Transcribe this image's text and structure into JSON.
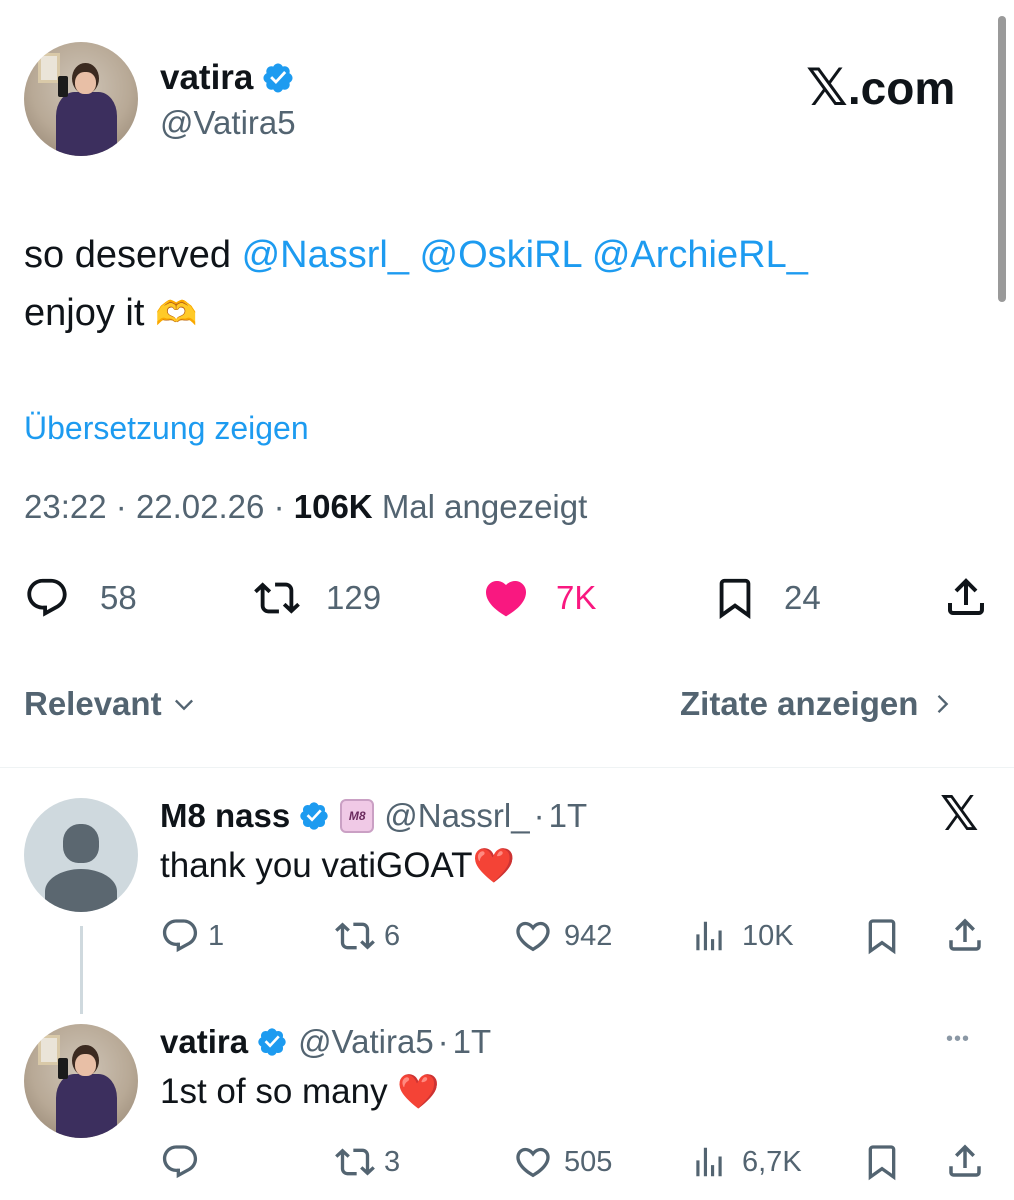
{
  "brand": {
    "logo_glyph": "𝕏",
    "logo_text": ".com"
  },
  "post": {
    "author_name": "vatira",
    "author_handle": "@Vatira5",
    "text_plain_1": "so deserved ",
    "mention_1": "@Nassrl_",
    "mention_2": "@OskiRL",
    "mention_3": "@ArchieRL_",
    "text_plain_2": "enjoy it ",
    "emoji": "🫶",
    "translate_label": "Übersetzung zeigen",
    "time": "23:22",
    "separator": "·",
    "date": "22.02.26",
    "views_count": "106K",
    "views_label": "Mal angezeigt",
    "actions": {
      "replies": "58",
      "reposts": "129",
      "likes": "7K",
      "bookmarks": "24"
    }
  },
  "sort": {
    "label": "Relevant",
    "quotes_label": "Zitate anzeigen"
  },
  "replies": [
    {
      "author_name": "M8 nass",
      "affiliate_badge": "M8",
      "author_handle": "@Nassrl_",
      "separator": "·",
      "time": "1T",
      "text": "thank you vatiGOAT",
      "emoji": "❤️",
      "corner_glyph": "𝕏",
      "actions": {
        "replies": "1",
        "reposts": "6",
        "likes": "942",
        "views": "10K"
      }
    },
    {
      "author_name": "vatira",
      "author_handle": "@Vatira5",
      "separator": "·",
      "time": "1T",
      "text": "1st of so many ",
      "emoji": "❤️",
      "corner_glyph": "•••",
      "actions": {
        "replies": "",
        "reposts": "3",
        "likes": "505",
        "views": "6,7K"
      }
    }
  ],
  "colors": {
    "accent": "#1d9bf0",
    "like_active": "#f91880",
    "muted": "#536471",
    "text": "#0f1419"
  },
  "icons": [
    "verified-badge-icon",
    "reply-icon",
    "repost-icon",
    "like-icon",
    "bookmark-icon",
    "share-icon",
    "views-icon",
    "chevron-down-icon",
    "chevron-right-icon",
    "x-logo-icon",
    "more-icon"
  ]
}
